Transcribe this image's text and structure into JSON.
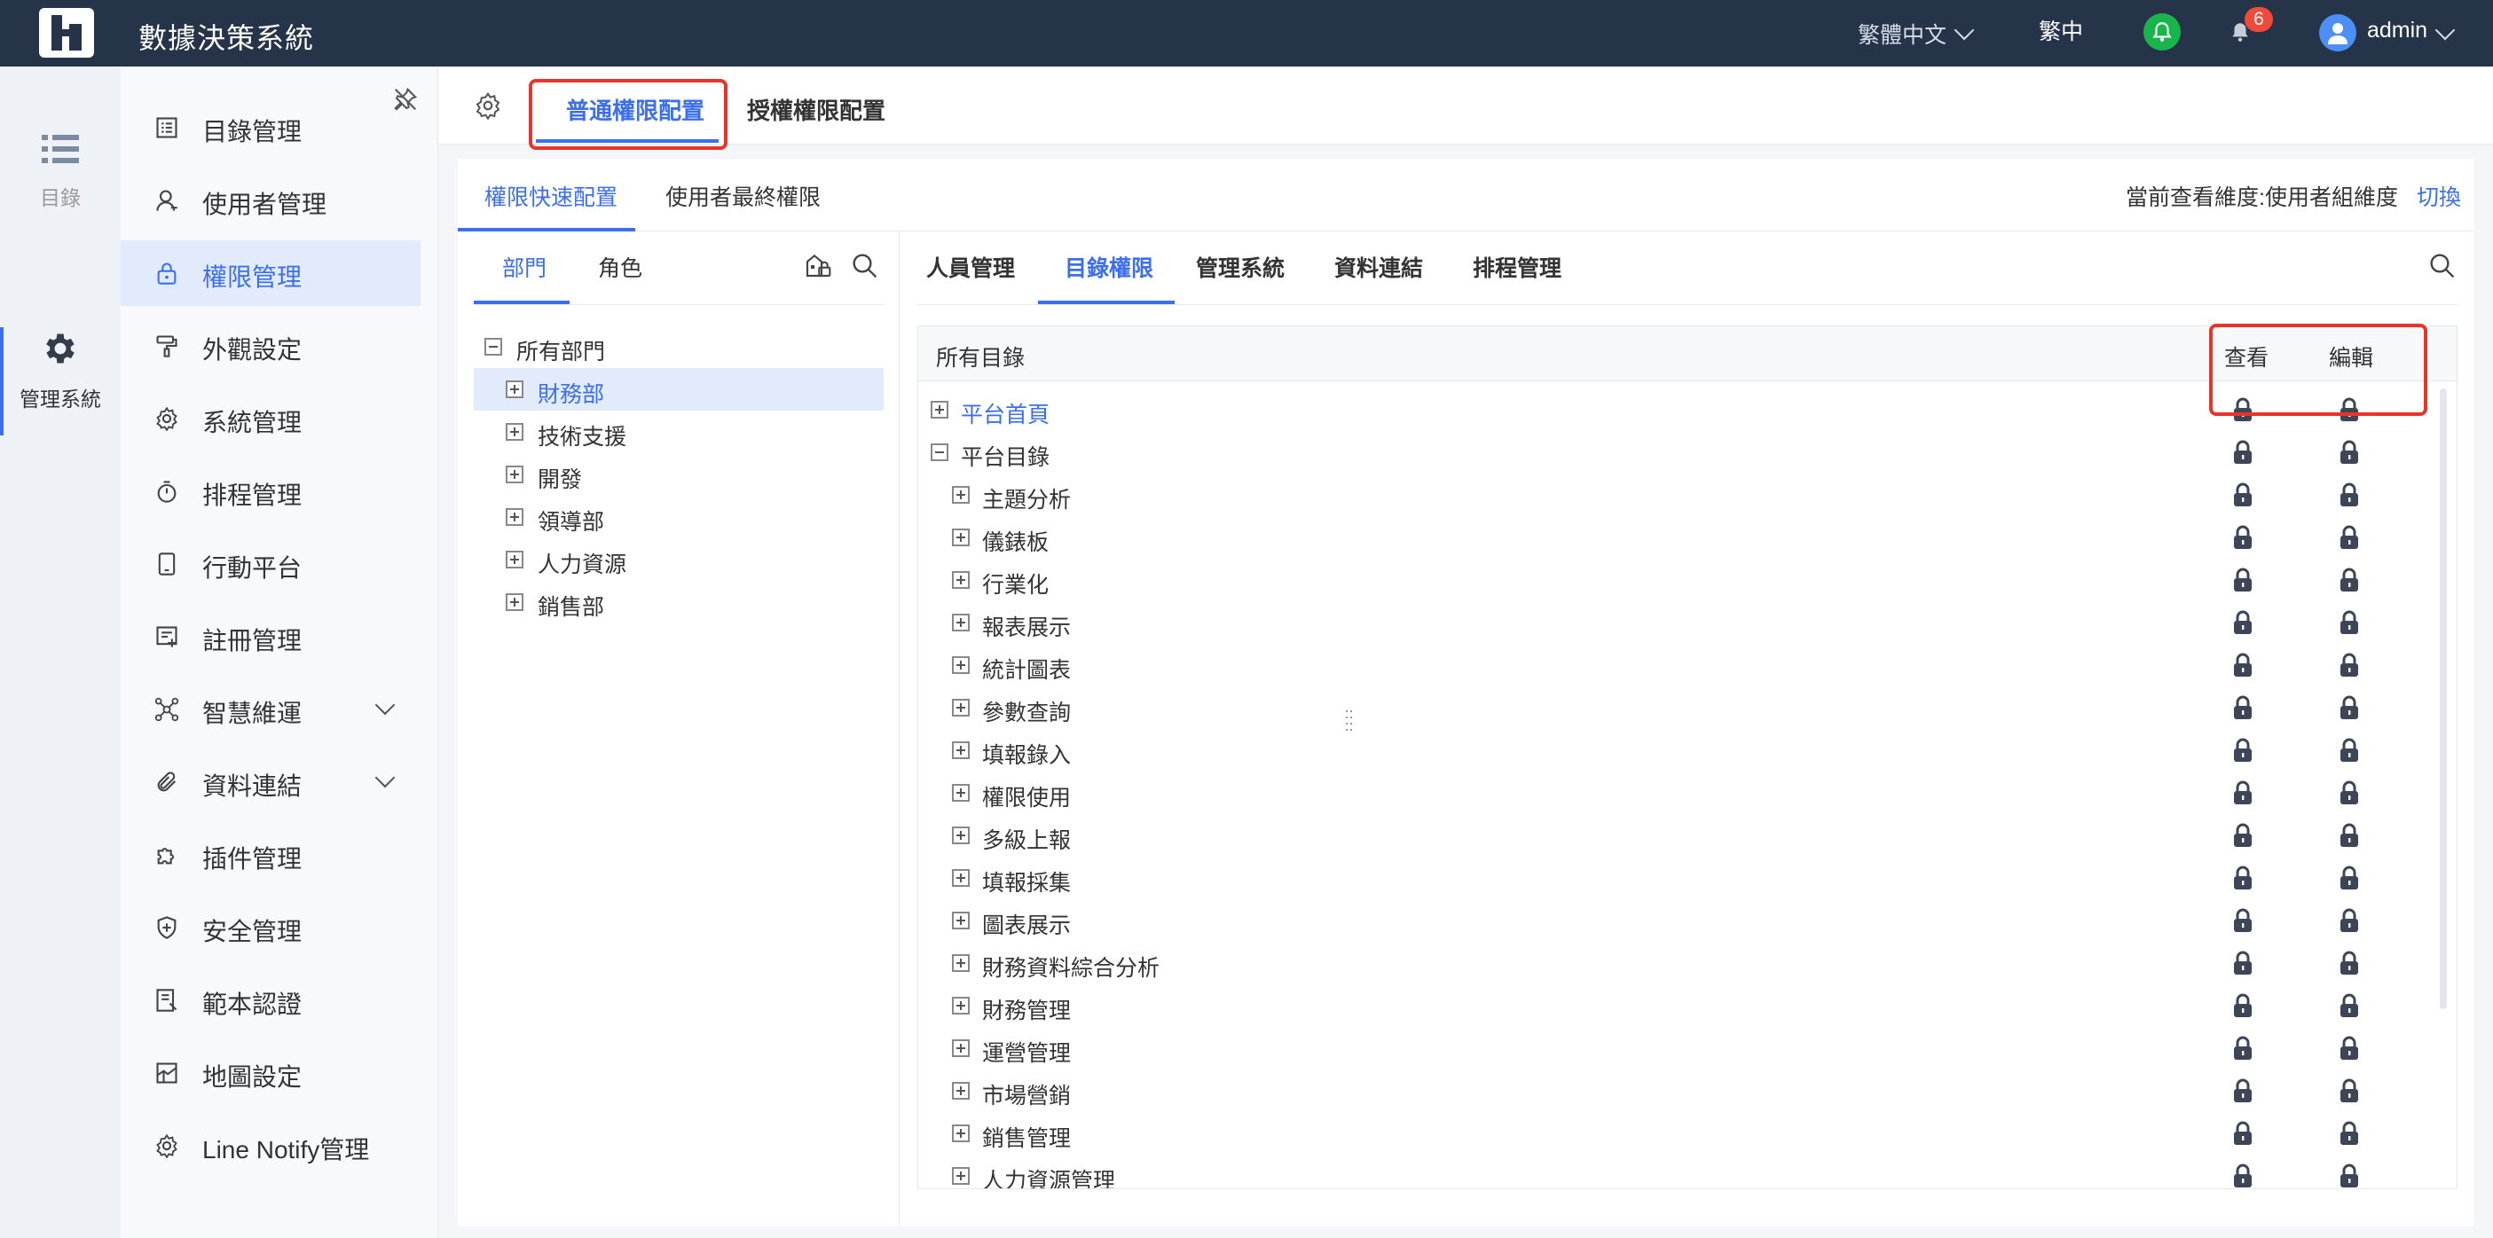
{
  "header": {
    "app_title": "數據決策系統",
    "language": "繁體中文",
    "language_short": "繁中",
    "notification_count": "6",
    "username": "admin"
  },
  "rail": {
    "items": [
      {
        "label": "目錄",
        "icon": "list-icon"
      },
      {
        "label": "管理系統",
        "icon": "gear-icon"
      }
    ]
  },
  "menu": {
    "items": [
      {
        "label": "目錄管理",
        "icon": "directory-icon"
      },
      {
        "label": "使用者管理",
        "icon": "user-icon"
      },
      {
        "label": "權限管理",
        "icon": "lock-icon"
      },
      {
        "label": "外觀設定",
        "icon": "paint-roller-icon"
      },
      {
        "label": "系統管理",
        "icon": "gear-icon"
      },
      {
        "label": "排程管理",
        "icon": "timer-icon"
      },
      {
        "label": "行動平台",
        "icon": "tablet-icon"
      },
      {
        "label": "註冊管理",
        "icon": "register-icon"
      },
      {
        "label": "智慧維運",
        "icon": "network-icon"
      },
      {
        "label": "資料連結",
        "icon": "paperclip-icon"
      },
      {
        "label": "插件管理",
        "icon": "puzzle-icon"
      },
      {
        "label": "安全管理",
        "icon": "shield-icon"
      },
      {
        "label": "範本認證",
        "icon": "template-icon"
      },
      {
        "label": "地圖設定",
        "icon": "map-icon"
      },
      {
        "label": "Line Notify管理",
        "icon": "gear-icon"
      }
    ]
  },
  "top_tabs": [
    "普通權限配置",
    "授權權限配置"
  ],
  "sub_tabs": [
    "權限快速配置",
    "使用者最終權限"
  ],
  "view_dimension": "當前查看維度:使用者組維度",
  "switch_label": "切換",
  "dept_tabs": [
    "部門",
    "角色"
  ],
  "dept_tree": {
    "root": "所有部門",
    "children": [
      "財務部",
      "技術支援",
      "開發",
      "領導部",
      "人力資源",
      "銷售部"
    ]
  },
  "right_tabs": [
    "人員管理",
    "目錄權限",
    "管理系統",
    "資料連結",
    "排程管理"
  ],
  "table": {
    "header_label": "所有目錄",
    "col_view": "查看",
    "col_edit": "編輯",
    "rows": [
      {
        "label": "平台首頁",
        "level": 0,
        "expanded": false,
        "link": true
      },
      {
        "label": "平台目錄",
        "level": 0,
        "expanded": true,
        "link": false
      },
      {
        "label": "主題分析",
        "level": 1,
        "expanded": false,
        "link": false
      },
      {
        "label": "儀錶板",
        "level": 1,
        "expanded": false,
        "link": false
      },
      {
        "label": "行業化",
        "level": 1,
        "expanded": false,
        "link": false
      },
      {
        "label": "報表展示",
        "level": 1,
        "expanded": false,
        "link": false
      },
      {
        "label": "統計圖表",
        "level": 1,
        "expanded": false,
        "link": false
      },
      {
        "label": "參數查詢",
        "level": 1,
        "expanded": false,
        "link": false
      },
      {
        "label": "填報錄入",
        "level": 1,
        "expanded": false,
        "link": false
      },
      {
        "label": "權限使用",
        "level": 1,
        "expanded": false,
        "link": false
      },
      {
        "label": "多級上報",
        "level": 1,
        "expanded": false,
        "link": false
      },
      {
        "label": "填報採集",
        "level": 1,
        "expanded": false,
        "link": false
      },
      {
        "label": "圖表展示",
        "level": 1,
        "expanded": false,
        "link": false
      },
      {
        "label": "財務資料綜合分析",
        "level": 1,
        "expanded": false,
        "link": false
      },
      {
        "label": "財務管理",
        "level": 1,
        "expanded": false,
        "link": false
      },
      {
        "label": "運營管理",
        "level": 1,
        "expanded": false,
        "link": false
      },
      {
        "label": "市場營銷",
        "level": 1,
        "expanded": false,
        "link": false
      },
      {
        "label": "銷售管理",
        "level": 1,
        "expanded": false,
        "link": false
      },
      {
        "label": "人力資源管理",
        "level": 1,
        "expanded": false,
        "link": false
      }
    ]
  },
  "colors": {
    "topbar": "#263449",
    "accent": "#3c6ef0",
    "highlight": "#e8352a",
    "selected_bg": "#e2ebfb"
  }
}
